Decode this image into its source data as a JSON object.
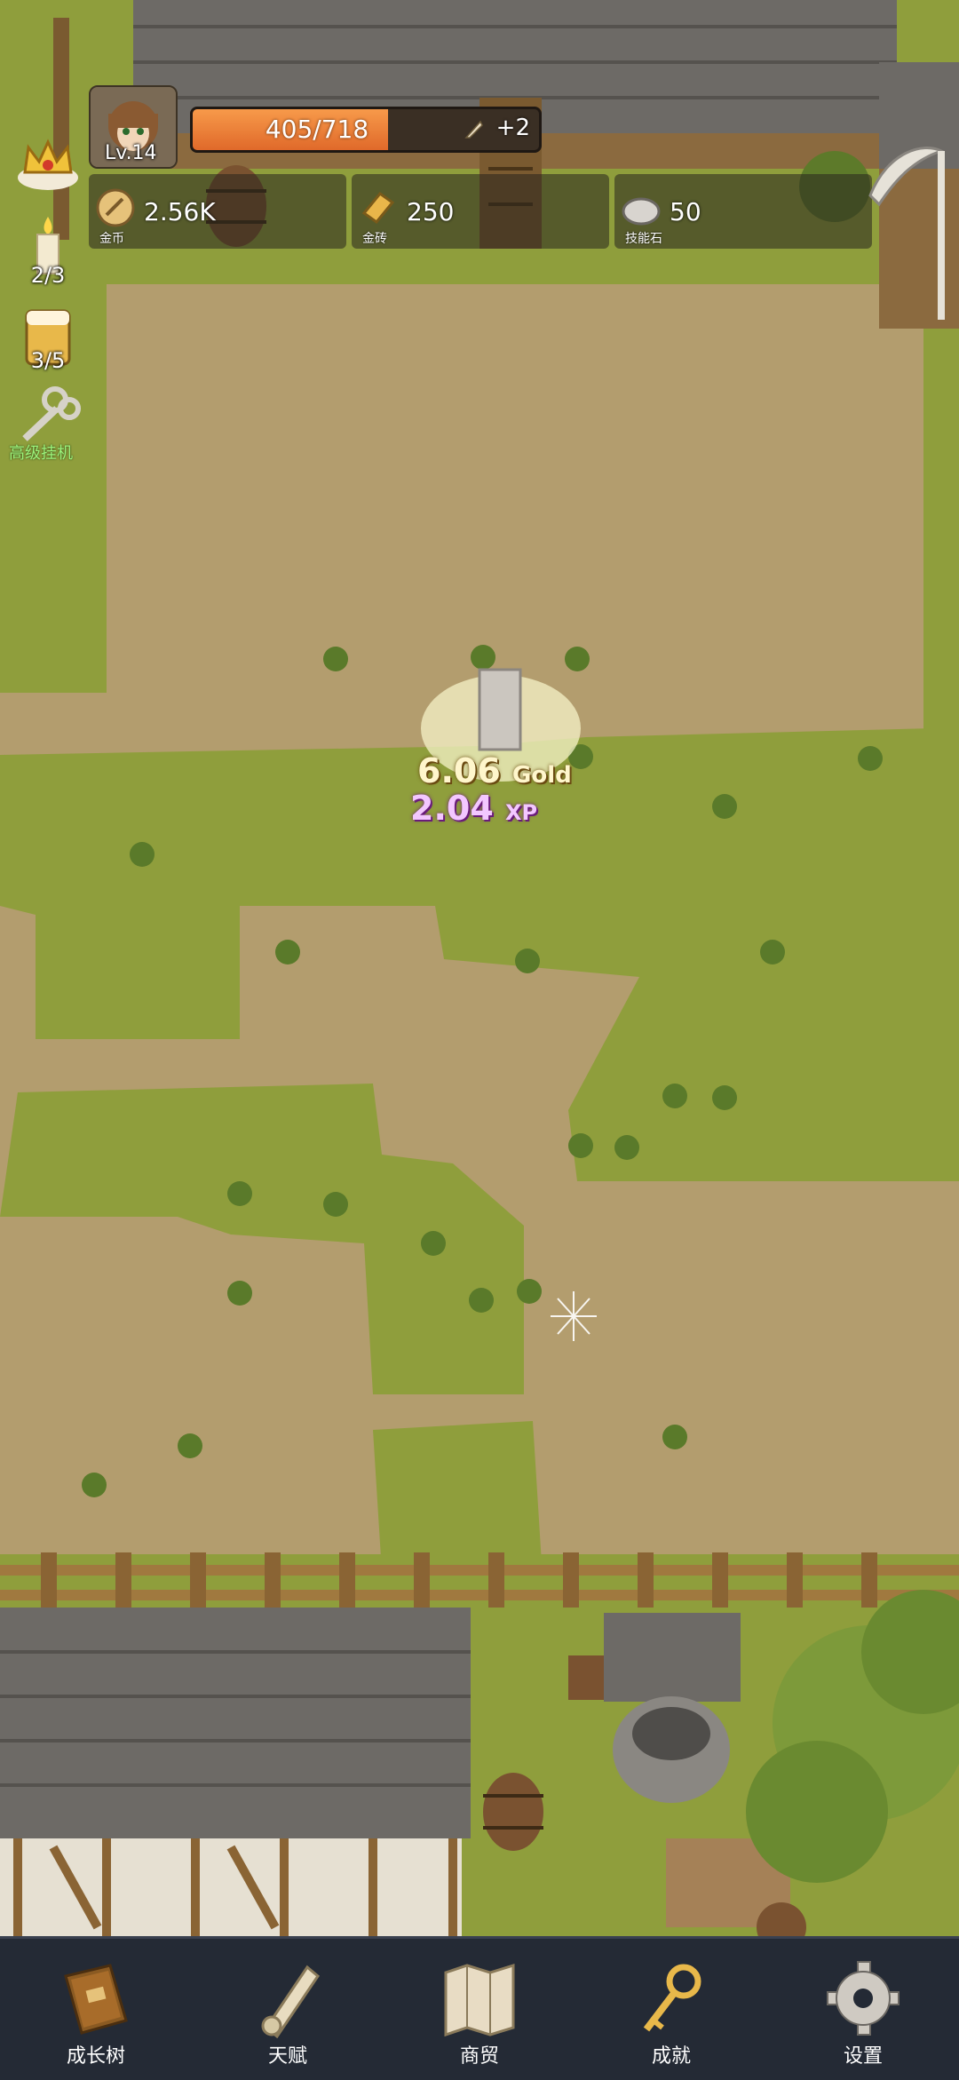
{
  "player": {
    "level": "Lv.14",
    "xp_current": 405,
    "xp_max": 718,
    "xp_text": "405/718",
    "xp_bonus": "+2"
  },
  "resources": [
    {
      "icon": "gold-coin-icon",
      "value": "2.56K",
      "label": "金币"
    },
    {
      "icon": "gold-brick-icon",
      "value": "250",
      "label": "金砖"
    },
    {
      "icon": "skill-stone-icon",
      "value": "50",
      "label": "技能石"
    }
  ],
  "side": {
    "candle_count": "2/3",
    "beer_count": "3/5",
    "idle_label": "高级挂机"
  },
  "floating": {
    "gold_value": "6.06",
    "gold_unit": "Gold",
    "xp_value": "2.04",
    "xp_unit": "XP"
  },
  "nav": [
    {
      "icon": "book-icon",
      "label": "成长树"
    },
    {
      "icon": "scroll-icon",
      "label": "天赋"
    },
    {
      "icon": "map-icon",
      "label": "商贸"
    },
    {
      "icon": "key-icon",
      "label": "成就"
    },
    {
      "icon": "gear-icon",
      "label": "设置"
    }
  ],
  "colors": {
    "xp_fill": "#f0843a",
    "grass": "#8f9e3c",
    "dirt": "#b39d6e",
    "nav_bg": "#242a35"
  }
}
